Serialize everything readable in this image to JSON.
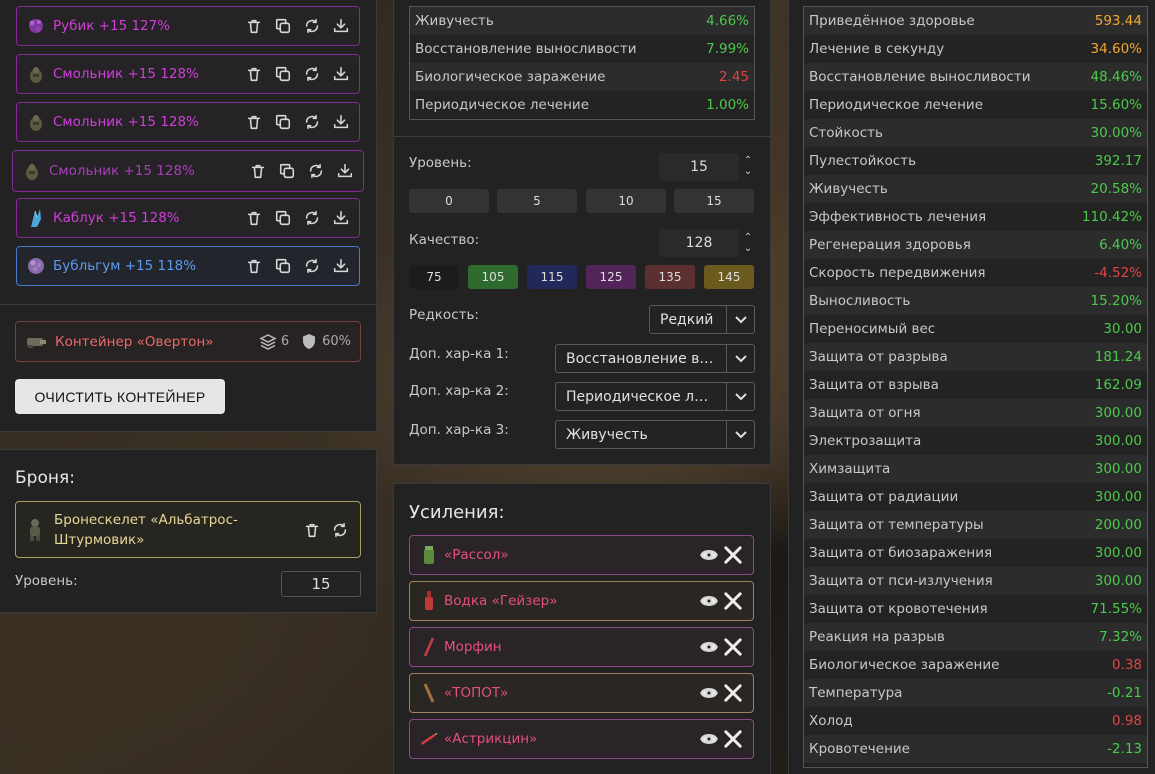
{
  "artifacts": [
    {
      "name": "Рубик +15 127%",
      "color": "#cf3fd9",
      "border": "#8a2a9a",
      "icon": "rubik-artifact-icon"
    },
    {
      "name": "Смольник +15 128%",
      "color": "#cf3fd9",
      "border": "#8a2a9a",
      "icon": "smolnik-artifact-icon"
    },
    {
      "name": "Смольник +15 128%",
      "color": "#cf3fd9",
      "border": "#8a2a9a",
      "icon": "smolnik-artifact-icon"
    },
    {
      "name": "Смольник +15 128%",
      "color": "#a83fb8",
      "border": "#8a2a9a",
      "icon": "smolnik-artifact-icon"
    },
    {
      "name": "Каблук +15 128%",
      "color": "#cf3fd9",
      "border": "#8a2a9a",
      "icon": "kabluk-artifact-icon"
    },
    {
      "name": "Бубльгум +15 118%",
      "color": "#5b9cf0",
      "border": "#4a7ad0",
      "icon": "bubblegum-artifact-icon"
    }
  ],
  "container": {
    "name": "Контейнер «Овертон»",
    "slots": "6",
    "protection": "60%",
    "clear_label": "ОЧИСТИТЬ КОНТЕЙНЕР"
  },
  "armor": {
    "heading": "Броня:",
    "name_line1": "Бронескелет «Альбатрос-",
    "name_line2": "Штурмовик»",
    "level_label": "Уровень:",
    "level_value": "15"
  },
  "artifact_stats": [
    {
      "label": "Живучесть",
      "value": "4.66%",
      "cls": "g"
    },
    {
      "label": "Восстановление выносливости",
      "value": "7.99%",
      "cls": "g"
    },
    {
      "label": "Биологическое заражение",
      "value": "2.45",
      "cls": "r"
    },
    {
      "label": "Периодическое лечение",
      "value": "1.00%",
      "cls": "g"
    }
  ],
  "editor": {
    "level_label": "Уровень:",
    "level_value": "15",
    "level_presets": [
      "0",
      "5",
      "10",
      "15"
    ],
    "quality_label": "Качество:",
    "quality_value": "128",
    "quality_presets": [
      {
        "v": "75",
        "bg": "#1c1c1c"
      },
      {
        "v": "105",
        "bg": "#2f6a2f"
      },
      {
        "v": "115",
        "bg": "#23285a"
      },
      {
        "v": "125",
        "bg": "#52245a"
      },
      {
        "v": "135",
        "bg": "#5c3030"
      },
      {
        "v": "145",
        "bg": "#6a5a1e"
      }
    ],
    "rarity_label": "Редкость:",
    "rarity_value": "Редкий",
    "extra1_label": "Доп. хар-ка 1:",
    "extra1_value": "Восстановление выносливости",
    "extra2_label": "Доп. хар-ка 2:",
    "extra2_value": "Периодическое лечение",
    "extra3_label": "Доп. хар-ка 3:",
    "extra3_value": "Живучесть"
  },
  "boosts": {
    "heading": "Усиления:",
    "items": [
      {
        "name": "«Рассол»",
        "icon": "brine-jar-icon"
      },
      {
        "name": "Водка «Гейзер»",
        "icon": "vodka-bottle-icon"
      },
      {
        "name": "Морфин",
        "icon": "morphine-syringe-icon"
      },
      {
        "name": "«ТОПОТ»",
        "icon": "topot-stick-icon"
      },
      {
        "name": "«Астрикцин»",
        "icon": "astrictin-syringe-icon"
      }
    ]
  },
  "total_stats": [
    {
      "label": "Приведённое здоровье",
      "value": "593.44",
      "cls": "o"
    },
    {
      "label": "Лечение в секунду",
      "value": "34.60%",
      "cls": "o"
    },
    {
      "label": "Восстановление выносливости",
      "value": "48.46%",
      "cls": "g"
    },
    {
      "label": "Периодическое лечение",
      "value": "15.60%",
      "cls": "g"
    },
    {
      "label": "Стойкость",
      "value": "30.00%",
      "cls": "g"
    },
    {
      "label": "Пулестойкость",
      "value": "392.17",
      "cls": "g"
    },
    {
      "label": "Живучесть",
      "value": "20.58%",
      "cls": "g"
    },
    {
      "label": "Эффективность лечения",
      "value": "110.42%",
      "cls": "g"
    },
    {
      "label": "Регенерация здоровья",
      "value": "6.40%",
      "cls": "g"
    },
    {
      "label": "Скорость передвижения",
      "value": "-4.52%",
      "cls": "r"
    },
    {
      "label": "Выносливость",
      "value": "15.20%",
      "cls": "g"
    },
    {
      "label": "Переносимый вес",
      "value": "30.00",
      "cls": "g"
    },
    {
      "label": "Защита от разрыва",
      "value": "181.24",
      "cls": "g"
    },
    {
      "label": "Защита от взрыва",
      "value": "162.09",
      "cls": "g"
    },
    {
      "label": "Защита от огня",
      "value": "300.00",
      "cls": "g"
    },
    {
      "label": "Электрозащита",
      "value": "300.00",
      "cls": "g"
    },
    {
      "label": "Химзащита",
      "value": "300.00",
      "cls": "g"
    },
    {
      "label": "Защита от радиации",
      "value": "300.00",
      "cls": "g"
    },
    {
      "label": "Защита от температуры",
      "value": "200.00",
      "cls": "g"
    },
    {
      "label": "Защита от биозаражения",
      "value": "300.00",
      "cls": "g"
    },
    {
      "label": "Защита от пси-излучения",
      "value": "300.00",
      "cls": "g"
    },
    {
      "label": "Защита от кровотечения",
      "value": "71.55%",
      "cls": "g"
    },
    {
      "label": "Реакция на разрыв",
      "value": "7.32%",
      "cls": "g"
    },
    {
      "label": "Биологическое заражение",
      "value": "0.38",
      "cls": "r"
    },
    {
      "label": "Температура",
      "value": "-0.21",
      "cls": "g"
    },
    {
      "label": "Холод",
      "value": "0.98",
      "cls": "r"
    },
    {
      "label": "Кровотечение",
      "value": "-2.13",
      "cls": "g"
    }
  ]
}
